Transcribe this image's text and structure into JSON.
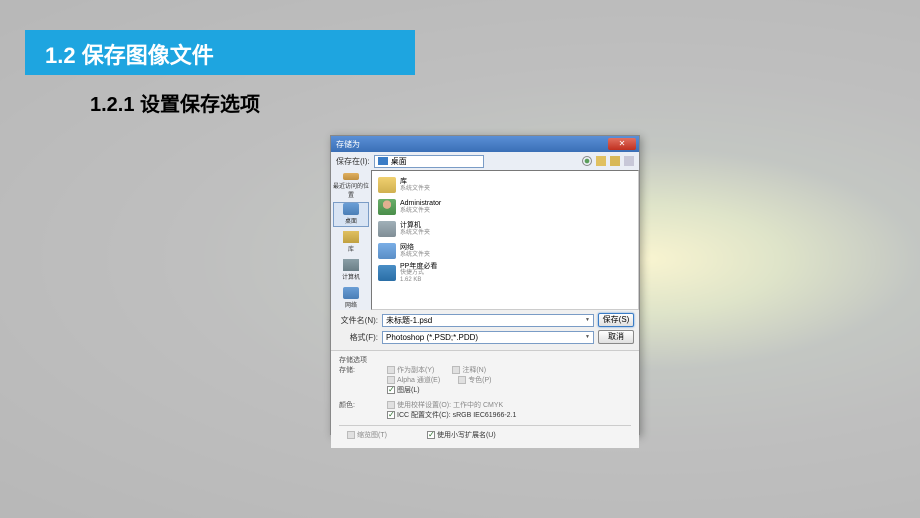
{
  "slide": {
    "section_title": "1.2  保存图像文件",
    "subsection_title": "1.2.1  设置保存选项"
  },
  "dialog": {
    "title": "存储为",
    "save_in_label": "保存在(I):",
    "save_in_value": "桌面",
    "places": {
      "recent": "最近访问的位置",
      "desktop": "桌面",
      "library": "库",
      "computer": "计算机",
      "network": "网络"
    },
    "files": [
      {
        "name": "库",
        "sub": "系统文件夹"
      },
      {
        "name": "Administrator",
        "sub": "系统文件夹"
      },
      {
        "name": "计算机",
        "sub": "系统文件夹"
      },
      {
        "name": "网络",
        "sub": "系统文件夹"
      },
      {
        "name": "PP年度必看",
        "sub": "快捷方式",
        "size": "1.62 KB"
      }
    ],
    "filename_label": "文件名(N):",
    "filename_value": "未标题-1.psd",
    "format_label": "格式(F):",
    "format_value": "Photoshop (*.PSD;*.PDD)",
    "save_btn": "保存(S)",
    "cancel_btn": "取消",
    "options": {
      "save_options_title": "存储选项",
      "save_title": "存储:",
      "as_copy": "作为副本(Y)",
      "annotations": "注释(N)",
      "alpha": "Alpha 通道(E)",
      "spot": "专色(P)",
      "layers": "图层(L)",
      "color_title": "颜色:",
      "proof": "使用校样设置(O): 工作中的 CMYK",
      "icc": "ICC 配置文件(C): sRGB IEC61966-2.1",
      "thumbnail": "缩览图(T)",
      "lowercase_ext": "使用小写扩展名(U)"
    }
  }
}
